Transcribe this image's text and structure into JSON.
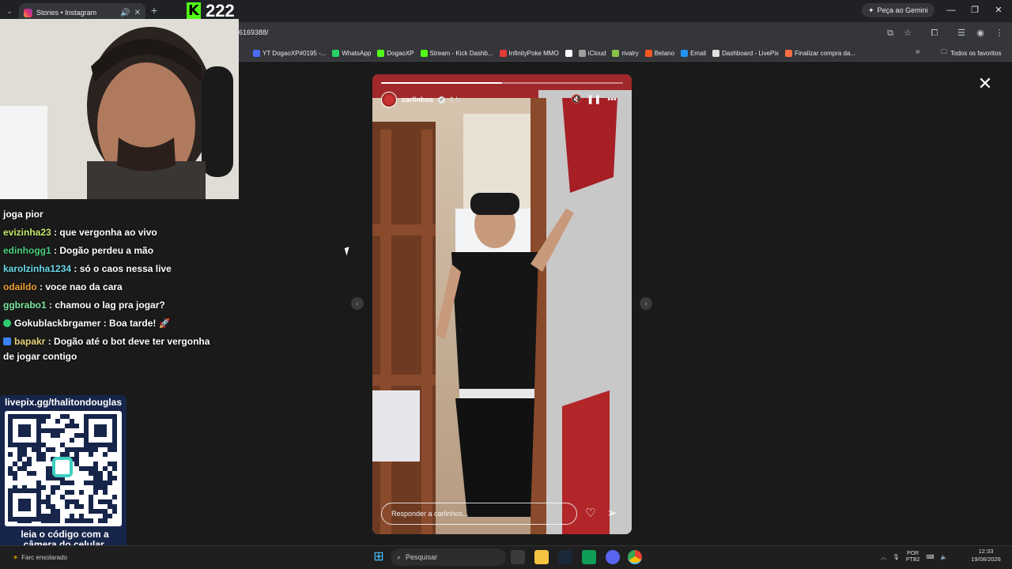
{
  "browser": {
    "tab_title": "Stories • Instagram",
    "new_tab": "+",
    "url": "6169388/",
    "gemini_label": "Peça ao Gemini",
    "bookmarks": [
      {
        "label": "YT DogaoXP#0195 -...",
        "color": "#4a6cf7"
      },
      {
        "label": "WhatsApp",
        "color": "#25d366"
      },
      {
        "label": "DogaoXP",
        "color": "#53fc18"
      },
      {
        "label": "Stream - Kick Dashb...",
        "color": "#53fc18"
      },
      {
        "label": "InfinityPoke MMO",
        "color": "#e53935"
      },
      {
        "label": "",
        "color": "#ffffff"
      },
      {
        "label": "iCloud",
        "color": "#9e9e9e"
      },
      {
        "label": "rivalry",
        "color": "#8bc34a"
      },
      {
        "label": "Betano",
        "color": "#ff5722"
      },
      {
        "label": "Email",
        "color": "#2196f3"
      },
      {
        "label": "Dashboard - LivePix",
        "color": "#e0e0e0"
      },
      {
        "label": "Finalizar compra da...",
        "color": "#ff7043"
      }
    ],
    "all_favorites": "Todos os favoritos"
  },
  "overlay": {
    "kick_count": "222"
  },
  "story": {
    "username": "carlinhos",
    "time": "1 h",
    "progress": 0.5,
    "reply_placeholder": "Responder a carlinhos..."
  },
  "chat": {
    "messages": [
      {
        "user": "",
        "text": "joga pior",
        "color": "#ffffff"
      },
      {
        "user": "evizinha23",
        "text": ": que vergonha ao vivo",
        "color": "#c6e86a"
      },
      {
        "user": "edinhogg1",
        "text": ": Dogão perdeu a mão",
        "color": "#4ad17e"
      },
      {
        "user": "karolzinha1234",
        "text": ": só o caos nessa live",
        "color": "#6ad9e8"
      },
      {
        "user": "odaildo",
        "text": ": voce nao da cara",
        "color": "#f0a030"
      },
      {
        "user": "ggbrabo1",
        "text": ": chamou o lag pra jogar?",
        "color": "#7de8a0"
      },
      {
        "user": "Gokublackbrgamer",
        "text": ": Boa tarde! 🚀",
        "color": "#ffffff"
      },
      {
        "user": "bapakr",
        "text": ": Dogão até o bot deve ter vergonha",
        "color": "#e8d47a"
      },
      {
        "user": "",
        "text": "de jogar contigo",
        "color": "#ffffff"
      }
    ]
  },
  "qr": {
    "url": "livepix.gg/thalitondouglas",
    "caption_line1": "leia o código com a",
    "caption_line2": "câmera do celular."
  },
  "taskbar": {
    "weather": "Farc ensolarado",
    "search_placeholder": "Pesquisar",
    "lang1": "POR",
    "lang2": "PTB2",
    "time": "12:33",
    "date": "19/08/2026"
  }
}
